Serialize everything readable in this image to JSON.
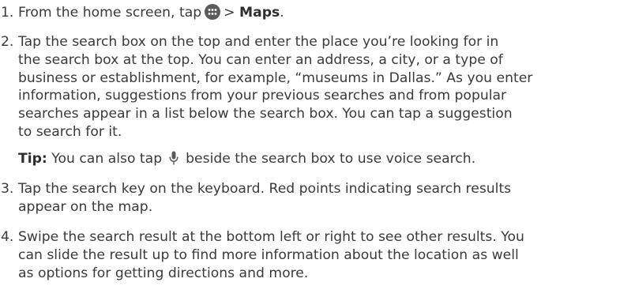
{
  "steps": [
    {
      "number": "1.",
      "line1_pre": "From the home screen, tap",
      "line1_mid": ">",
      "line1_bold": "Maps",
      "line1_end": "."
    },
    {
      "number": "2.",
      "lines": [
        "Tap the search box on the top and enter the place you’re looking for in",
        "the search box at the top. You can enter an address, a city, or a type of",
        "business or establishment, for example, “museums in Dallas.” As you enter",
        "information, suggestions from your previous searches and from popular",
        "searches appear in a list below the search box. You can tap a suggestion",
        "to search for it."
      ]
    },
    {
      "number": "3.",
      "lines": [
        "Tap the search key on the keyboard. Red points indicating search results",
        "appear on the map."
      ]
    },
    {
      "number": "4.",
      "lines": [
        "Swipe the search result at the bottom left or right to see other results. You",
        "can slide the result up to find more information about the location as well",
        "as options for getting directions and more."
      ]
    }
  ],
  "tip": {
    "label": "Tip:",
    "pre": "You can also tap",
    "post": "beside the search box to use voice search."
  },
  "icons": {
    "apps": "apps-grid-icon",
    "mic": "microphone-icon"
  }
}
